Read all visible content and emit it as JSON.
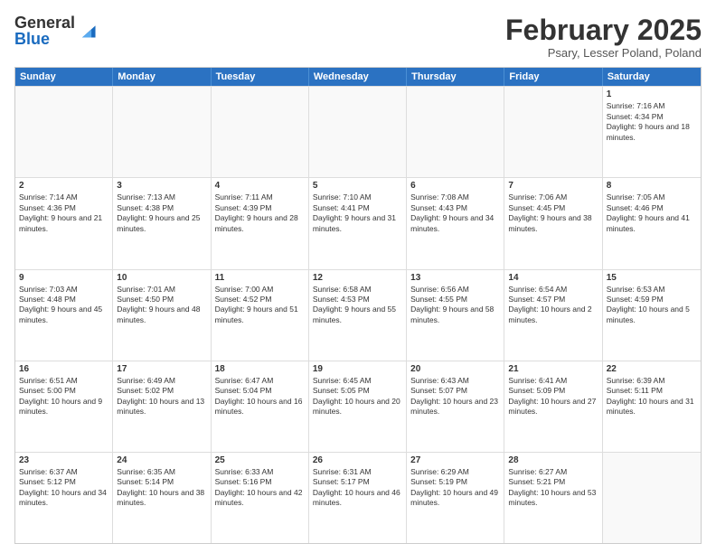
{
  "logo": {
    "general": "General",
    "blue": "Blue"
  },
  "title": "February 2025",
  "location": "Psary, Lesser Poland, Poland",
  "days": [
    "Sunday",
    "Monday",
    "Tuesday",
    "Wednesday",
    "Thursday",
    "Friday",
    "Saturday"
  ],
  "rows": [
    [
      {
        "day": "",
        "info": ""
      },
      {
        "day": "",
        "info": ""
      },
      {
        "day": "",
        "info": ""
      },
      {
        "day": "",
        "info": ""
      },
      {
        "day": "",
        "info": ""
      },
      {
        "day": "",
        "info": ""
      },
      {
        "day": "1",
        "info": "Sunrise: 7:16 AM\nSunset: 4:34 PM\nDaylight: 9 hours and 18 minutes."
      }
    ],
    [
      {
        "day": "2",
        "info": "Sunrise: 7:14 AM\nSunset: 4:36 PM\nDaylight: 9 hours and 21 minutes."
      },
      {
        "day": "3",
        "info": "Sunrise: 7:13 AM\nSunset: 4:38 PM\nDaylight: 9 hours and 25 minutes."
      },
      {
        "day": "4",
        "info": "Sunrise: 7:11 AM\nSunset: 4:39 PM\nDaylight: 9 hours and 28 minutes."
      },
      {
        "day": "5",
        "info": "Sunrise: 7:10 AM\nSunset: 4:41 PM\nDaylight: 9 hours and 31 minutes."
      },
      {
        "day": "6",
        "info": "Sunrise: 7:08 AM\nSunset: 4:43 PM\nDaylight: 9 hours and 34 minutes."
      },
      {
        "day": "7",
        "info": "Sunrise: 7:06 AM\nSunset: 4:45 PM\nDaylight: 9 hours and 38 minutes."
      },
      {
        "day": "8",
        "info": "Sunrise: 7:05 AM\nSunset: 4:46 PM\nDaylight: 9 hours and 41 minutes."
      }
    ],
    [
      {
        "day": "9",
        "info": "Sunrise: 7:03 AM\nSunset: 4:48 PM\nDaylight: 9 hours and 45 minutes."
      },
      {
        "day": "10",
        "info": "Sunrise: 7:01 AM\nSunset: 4:50 PM\nDaylight: 9 hours and 48 minutes."
      },
      {
        "day": "11",
        "info": "Sunrise: 7:00 AM\nSunset: 4:52 PM\nDaylight: 9 hours and 51 minutes."
      },
      {
        "day": "12",
        "info": "Sunrise: 6:58 AM\nSunset: 4:53 PM\nDaylight: 9 hours and 55 minutes."
      },
      {
        "day": "13",
        "info": "Sunrise: 6:56 AM\nSunset: 4:55 PM\nDaylight: 9 hours and 58 minutes."
      },
      {
        "day": "14",
        "info": "Sunrise: 6:54 AM\nSunset: 4:57 PM\nDaylight: 10 hours and 2 minutes."
      },
      {
        "day": "15",
        "info": "Sunrise: 6:53 AM\nSunset: 4:59 PM\nDaylight: 10 hours and 5 minutes."
      }
    ],
    [
      {
        "day": "16",
        "info": "Sunrise: 6:51 AM\nSunset: 5:00 PM\nDaylight: 10 hours and 9 minutes."
      },
      {
        "day": "17",
        "info": "Sunrise: 6:49 AM\nSunset: 5:02 PM\nDaylight: 10 hours and 13 minutes."
      },
      {
        "day": "18",
        "info": "Sunrise: 6:47 AM\nSunset: 5:04 PM\nDaylight: 10 hours and 16 minutes."
      },
      {
        "day": "19",
        "info": "Sunrise: 6:45 AM\nSunset: 5:05 PM\nDaylight: 10 hours and 20 minutes."
      },
      {
        "day": "20",
        "info": "Sunrise: 6:43 AM\nSunset: 5:07 PM\nDaylight: 10 hours and 23 minutes."
      },
      {
        "day": "21",
        "info": "Sunrise: 6:41 AM\nSunset: 5:09 PM\nDaylight: 10 hours and 27 minutes."
      },
      {
        "day": "22",
        "info": "Sunrise: 6:39 AM\nSunset: 5:11 PM\nDaylight: 10 hours and 31 minutes."
      }
    ],
    [
      {
        "day": "23",
        "info": "Sunrise: 6:37 AM\nSunset: 5:12 PM\nDaylight: 10 hours and 34 minutes."
      },
      {
        "day": "24",
        "info": "Sunrise: 6:35 AM\nSunset: 5:14 PM\nDaylight: 10 hours and 38 minutes."
      },
      {
        "day": "25",
        "info": "Sunrise: 6:33 AM\nSunset: 5:16 PM\nDaylight: 10 hours and 42 minutes."
      },
      {
        "day": "26",
        "info": "Sunrise: 6:31 AM\nSunset: 5:17 PM\nDaylight: 10 hours and 46 minutes."
      },
      {
        "day": "27",
        "info": "Sunrise: 6:29 AM\nSunset: 5:19 PM\nDaylight: 10 hours and 49 minutes."
      },
      {
        "day": "28",
        "info": "Sunrise: 6:27 AM\nSunset: 5:21 PM\nDaylight: 10 hours and 53 minutes."
      },
      {
        "day": "",
        "info": ""
      }
    ]
  ]
}
